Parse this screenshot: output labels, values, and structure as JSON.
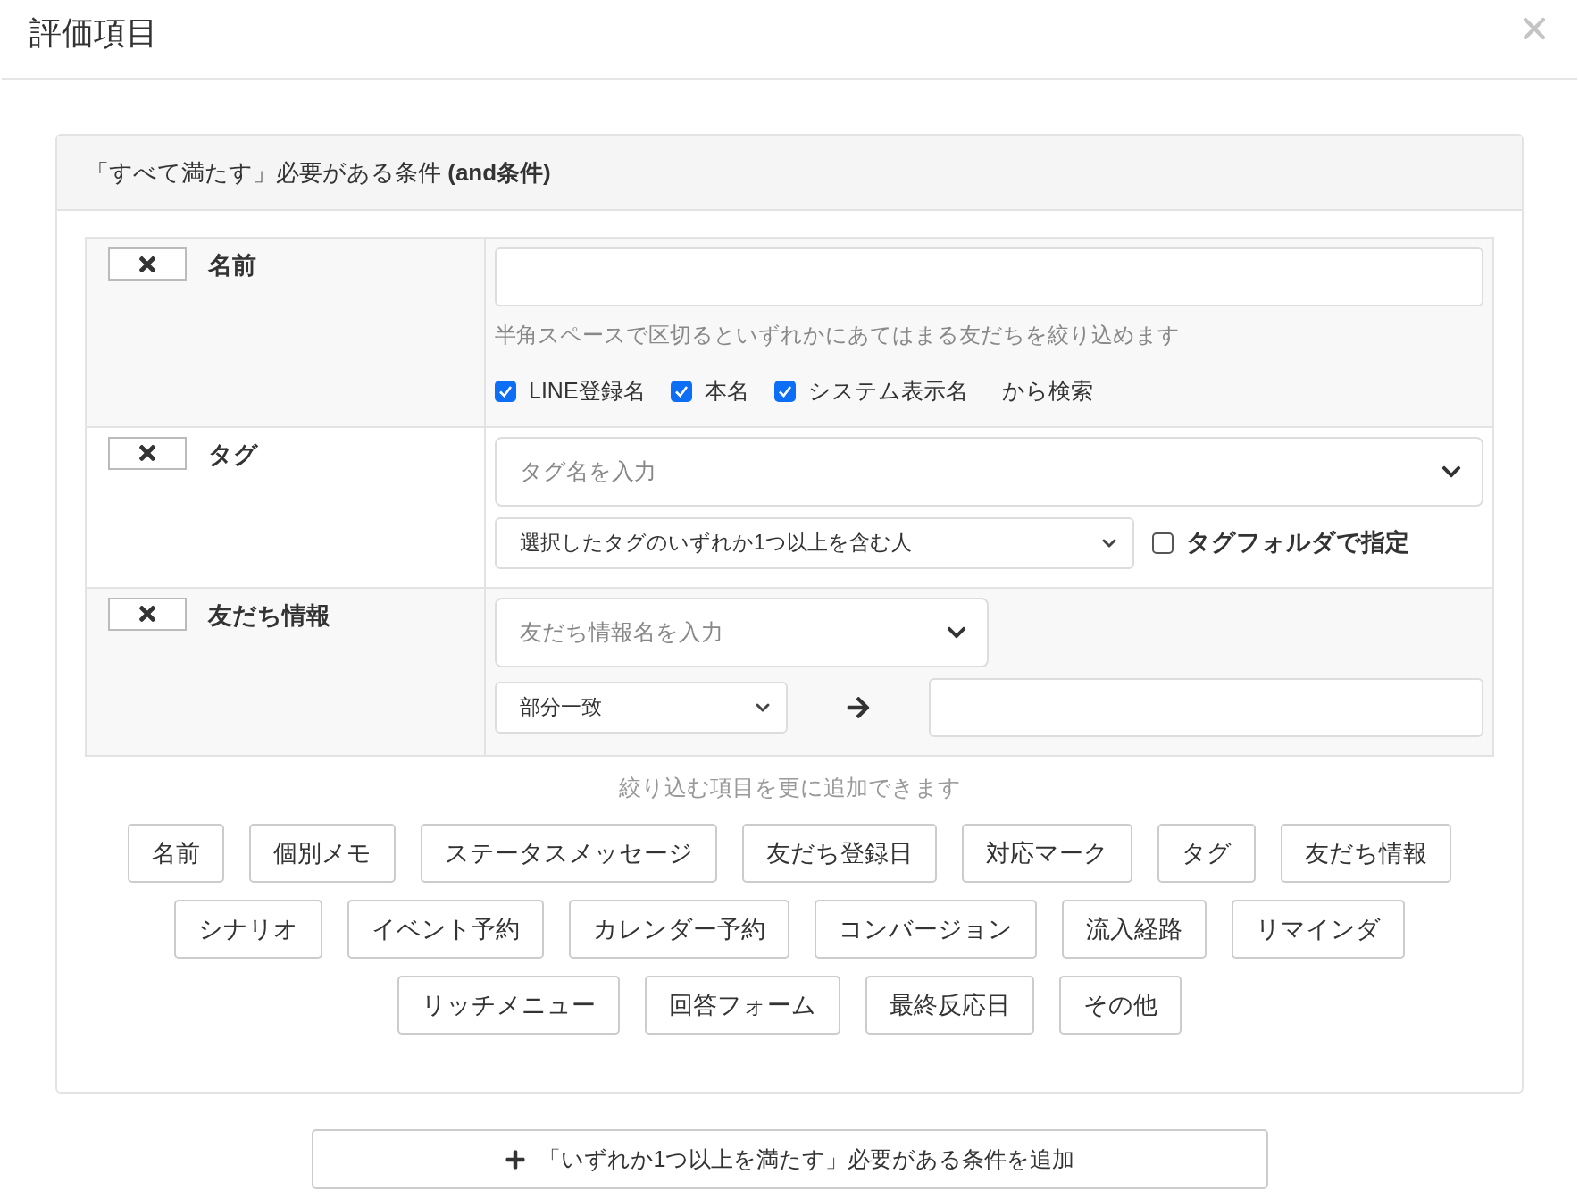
{
  "dialog": {
    "title": "評価項目"
  },
  "and_group": {
    "title": "「すべて満たす」必要がある条件 **(and条件)**",
    "conditions": [
      {
        "kind": "name",
        "label": "名前",
        "hint": "半角スペースで区切るといずれかにあてはまる友だちを絞り込めます",
        "options": [
          {
            "label": "LINE登録名",
            "checked": true
          },
          {
            "label": "本名",
            "checked": true
          },
          {
            "label": "システム表示名",
            "checked": true
          }
        ],
        "suffix": "から検索"
      },
      {
        "kind": "tag",
        "label": "タグ",
        "picker": {
          "placeholder": "タグ名を入力"
        },
        "match": "選択したタグのいずれか1つ以上を含む人",
        "folder_option": {
          "label": "タグフォルダで指定",
          "checked": false
        }
      },
      {
        "kind": "friend_info",
        "label": "友だち情報",
        "picker": {
          "placeholder": "友だち情報名を入力"
        },
        "match": "部分一致"
      }
    ],
    "add_hint": "絞り込む項目を更に追加できます",
    "add_buttons": [
      "名前",
      "個別メモ",
      "ステータスメッセージ",
      "友だち登録日",
      "対応マーク",
      "タグ",
      "友だち情報",
      "シナリオ",
      "イベント予約",
      "カレンダー予約",
      "コンバージョン",
      "流入経路",
      "リマインダ",
      "リッチメニュー",
      "回答フォーム",
      "最終反応日",
      "その他"
    ]
  },
  "add_or_button": {
    "label": "「いずれか1つ以上を満たす」必要がある条件を追加"
  }
}
